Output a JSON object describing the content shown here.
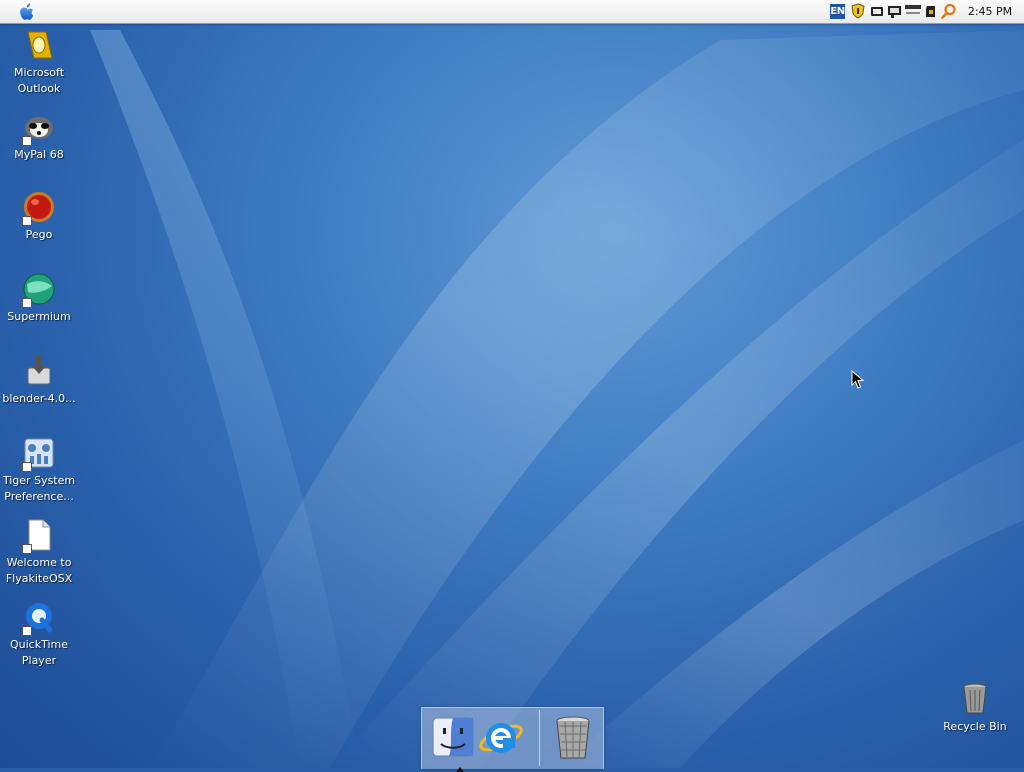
{
  "menubar": {
    "apple_icon": "apple-icon",
    "tray": {
      "language": "EN",
      "icons": [
        "security-shield-icon",
        "battery-icon",
        "chat-icon",
        "network-icon",
        "usb-drive-icon",
        "magnifier-icon"
      ]
    },
    "clock": "2:45 PM"
  },
  "desktop_icons": [
    {
      "label": "Microsoft Outlook",
      "icon": "outlook-icon"
    },
    {
      "label": "MyPal 68",
      "icon": "mypal-raccoon-icon"
    },
    {
      "label": "Pego",
      "icon": "pego-red-ball-icon"
    },
    {
      "label": "Supermium",
      "icon": "supermium-globe-icon"
    },
    {
      "label": "blender-4.0...",
      "icon": "installer-disk-icon"
    },
    {
      "label": "Tiger System Preference...",
      "icon": "system-preferences-icon"
    },
    {
      "label": "Welcome to FlyakiteOSX",
      "icon": "text-document-icon"
    },
    {
      "label": "QuickTime Player",
      "icon": "quicktime-icon"
    }
  ],
  "recycle_bin": {
    "label": "Recycle Bin",
    "icon": "recycle-bin-icon"
  },
  "dock": {
    "items": [
      {
        "name": "Finder",
        "icon": "finder-icon",
        "running": true
      },
      {
        "name": "Internet Explorer",
        "icon": "internet-explorer-icon",
        "running": false
      },
      {
        "name": "Trash",
        "icon": "trash-icon",
        "running": false
      }
    ]
  },
  "colors": {
    "wallpaper": "#2b62ad",
    "menubar": "#f2f2f2",
    "label_text": "#ffffff"
  }
}
